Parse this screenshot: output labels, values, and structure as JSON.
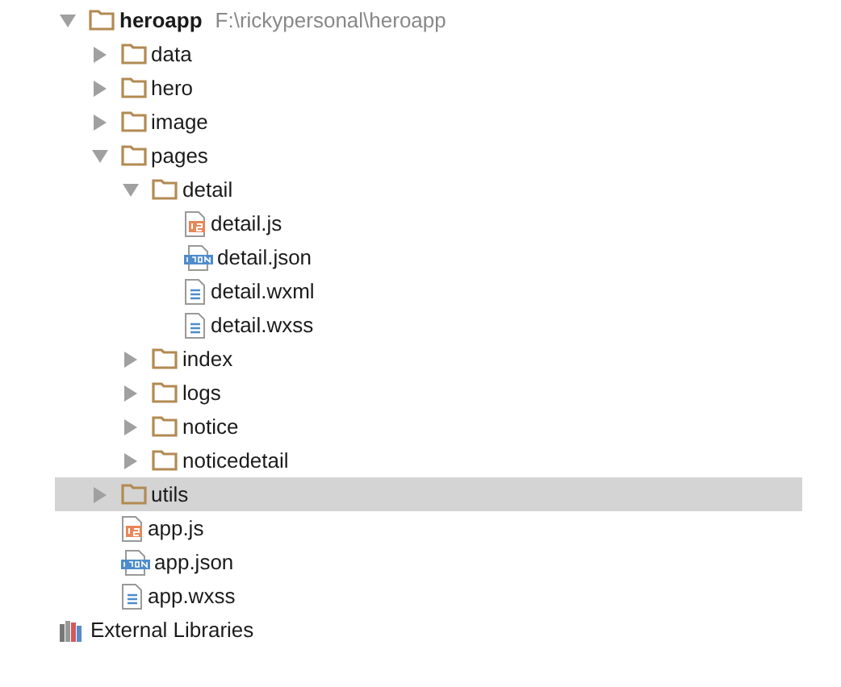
{
  "tree": [
    {
      "name": "heroapp",
      "kind": "folder",
      "path": "F:\\rickypersonal\\heroapp",
      "expanded": true,
      "selected": false,
      "children": [
        {
          "name": "data",
          "kind": "folder",
          "expanded": false,
          "selected": false
        },
        {
          "name": "hero",
          "kind": "folder",
          "expanded": false,
          "selected": false
        },
        {
          "name": "image",
          "kind": "folder",
          "expanded": false,
          "selected": false
        },
        {
          "name": "pages",
          "kind": "folder",
          "expanded": true,
          "selected": false,
          "children": [
            {
              "name": "detail",
              "kind": "folder",
              "expanded": true,
              "selected": false,
              "children": [
                {
                  "name": "detail.js",
                  "kind": "script",
                  "selected": false
                },
                {
                  "name": "detail.json",
                  "kind": "json",
                  "selected": false
                },
                {
                  "name": "detail.wxml",
                  "kind": "document",
                  "selected": false
                },
                {
                  "name": "detail.wxss",
                  "kind": "document",
                  "selected": false
                }
              ]
            },
            {
              "name": "index",
              "kind": "folder",
              "expanded": false,
              "selected": false
            },
            {
              "name": "logs",
              "kind": "folder",
              "expanded": false,
              "selected": false
            },
            {
              "name": "notice",
              "kind": "folder",
              "expanded": false,
              "selected": false
            },
            {
              "name": "noticedetail",
              "kind": "folder",
              "expanded": false,
              "selected": false
            }
          ]
        },
        {
          "name": "utils",
          "kind": "folder",
          "expanded": false,
          "selected": true
        },
        {
          "name": "app.js",
          "kind": "script",
          "selected": false
        },
        {
          "name": "app.json",
          "kind": "json",
          "selected": false
        },
        {
          "name": "app.wxss",
          "kind": "document",
          "selected": false
        }
      ]
    },
    {
      "name": "External Libraries",
      "kind": "library",
      "selected": false
    }
  ]
}
